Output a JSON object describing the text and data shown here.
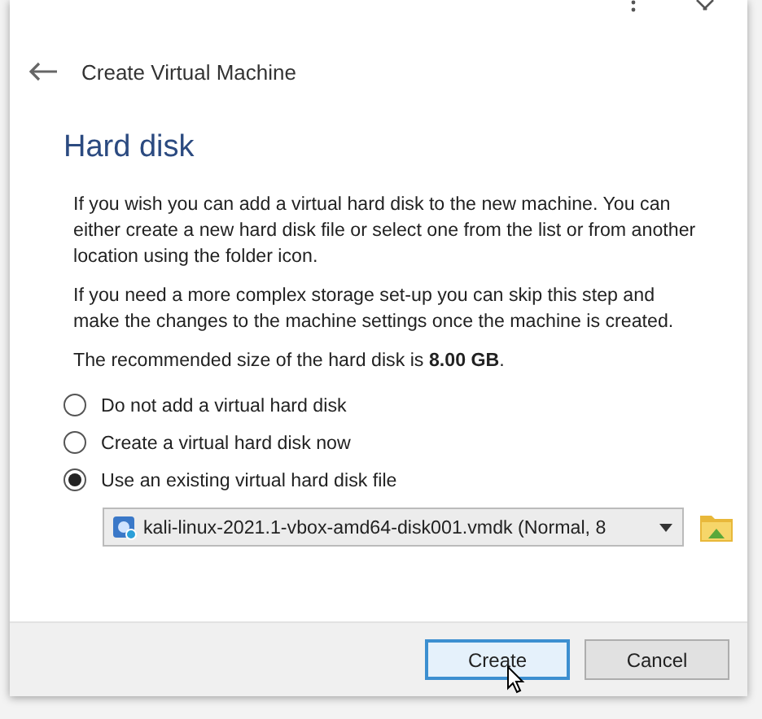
{
  "header": {
    "title": "Create Virtual Machine"
  },
  "page": {
    "heading": "Hard disk",
    "paragraphs": [
      "If you wish you can add a virtual hard disk to the new machine. You can either create a new hard disk file or select one from the list or from another location using the folder icon.",
      "If you need a more complex storage set-up you can skip this step and make the changes to the machine settings once the machine is created.",
      "The recommended size of the hard disk is **8.00 GB**."
    ]
  },
  "options": [
    {
      "label": "Do not add a virtual hard disk",
      "selected": false
    },
    {
      "label": "Create a virtual hard disk now",
      "selected": false
    },
    {
      "label": "Use an existing virtual hard disk file",
      "selected": true
    }
  ],
  "disk_select": {
    "value": "kali-linux-2021.1-vbox-amd64-disk001.vmdk (Normal, 8"
  },
  "buttons": [
    {
      "label": "Create",
      "default": true
    },
    {
      "label": "Cancel",
      "default": false
    }
  ]
}
